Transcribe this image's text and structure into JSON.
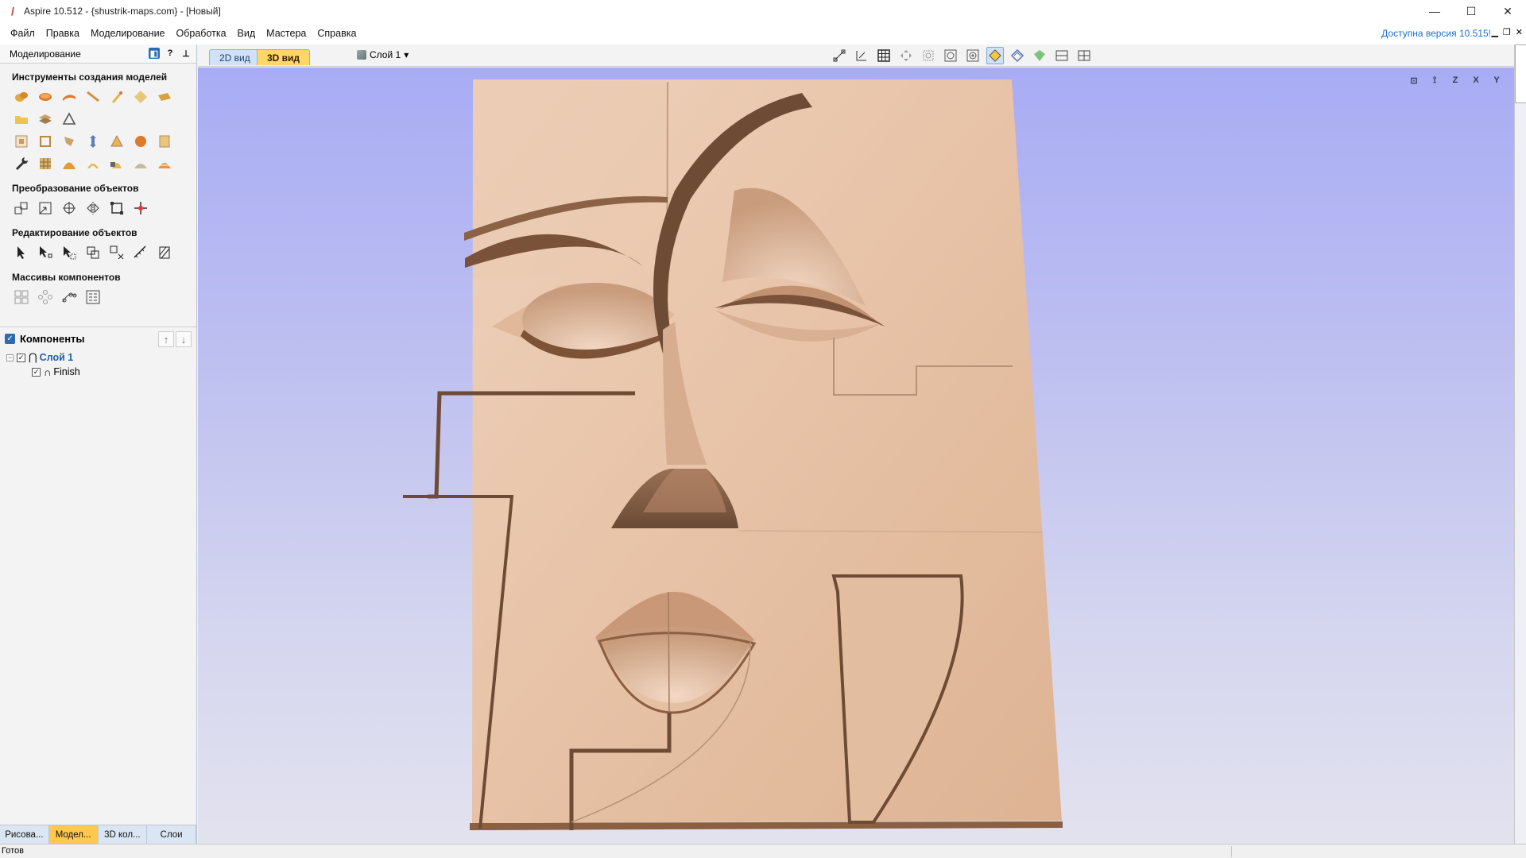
{
  "window": {
    "title": "Aspire 10.512 - {shustrik-maps.com} - [Новый]",
    "controls": {
      "minimize": "—",
      "maximize": "☐",
      "close": "✕"
    }
  },
  "menu": {
    "items": [
      "Файл",
      "Правка",
      "Моделирование",
      "Обработка",
      "Вид",
      "Мастера",
      "Справка"
    ],
    "update_notice": "Доступна версия 10.515!"
  },
  "left_panel": {
    "title": "Моделирование",
    "sections": {
      "create_models": "Инструменты создания моделей",
      "transform": "Преобразование объектов",
      "edit": "Редактирование объектов",
      "arrays": "Массивы компонентов"
    },
    "components": {
      "header": "Компоненты",
      "layer": "Слой 1",
      "item": "Finish"
    },
    "bottom_tabs": [
      "Рисова...",
      "Модел...",
      "3D кол...",
      "Слои"
    ],
    "active_bottom_tab": "Модел..."
  },
  "view_tabs": {
    "tab_2d": "2D вид",
    "tab_3d": "3D вид",
    "active": "3D вид",
    "layer_dropdown": "Слой 1"
  },
  "orientation_labels": [
    "Z",
    "X",
    "Y"
  ],
  "colors": {
    "accent_tab": "#ffd767",
    "link": "#1a73c9",
    "wood": "#e8c2a8",
    "viewport_top": "#a8acf4"
  },
  "status": {
    "text": "Готов"
  }
}
